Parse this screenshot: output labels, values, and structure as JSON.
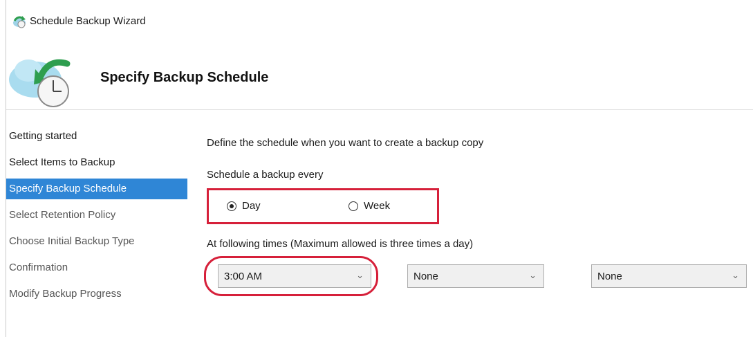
{
  "window": {
    "title": "Schedule Backup Wizard",
    "icon": "cloud-backup-icon"
  },
  "header": {
    "title": "Specify Backup Schedule",
    "icon": "cloud-clock-icon"
  },
  "sidebar": {
    "items": [
      {
        "label": "Getting started",
        "state": "normal"
      },
      {
        "label": "Select Items to Backup",
        "state": "normal"
      },
      {
        "label": "Specify Backup Schedule",
        "state": "active"
      },
      {
        "label": "Select Retention Policy",
        "state": "disabled"
      },
      {
        "label": "Choose Initial Backup Type",
        "state": "disabled"
      },
      {
        "label": "Confirmation",
        "state": "disabled"
      },
      {
        "label": "Modify Backup Progress",
        "state": "disabled"
      }
    ]
  },
  "main": {
    "description": "Define the schedule when you want to create a backup copy",
    "schedule_label": "Schedule a backup every",
    "frequency": {
      "options": [
        {
          "label": "Day",
          "selected": true
        },
        {
          "label": "Week",
          "selected": false
        }
      ]
    },
    "times_label": "At following times (Maximum allowed is three times a day)",
    "times": [
      {
        "value": "3:00 AM"
      },
      {
        "value": "None"
      },
      {
        "value": "None"
      }
    ]
  },
  "colors": {
    "accent": "#2f86d6",
    "annotation": "#d6203a"
  }
}
